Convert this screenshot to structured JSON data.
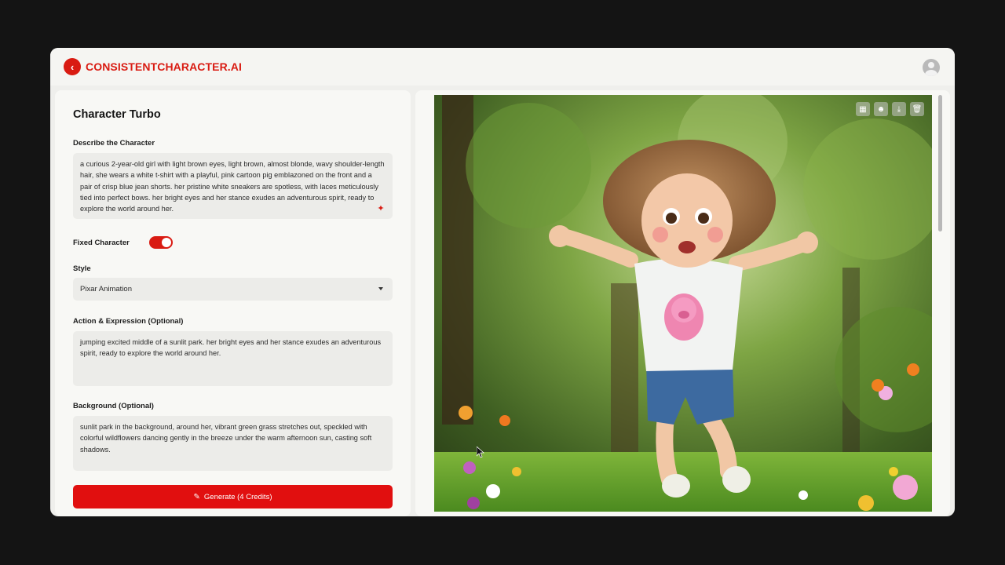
{
  "brand": {
    "name": "CONSISTENTCHARACTER.AI"
  },
  "form": {
    "title": "Character Turbo",
    "describe_label": "Describe the Character",
    "describe_value": "a curious 2-year-old girl with light brown eyes, light brown, almost blonde, wavy shoulder-length hair, she wears a white t-shirt with a playful, pink cartoon pig emblazoned on the front and a pair of crisp blue jean shorts. her pristine white sneakers are spotless, with laces meticulously tied into perfect bows. her bright eyes and her stance exudes an adventurous spirit, ready to explore the world around her.",
    "fixed_character_label": "Fixed Character",
    "fixed_character_on": true,
    "style_label": "Style",
    "style_value": "Pixar Animation",
    "action_label": "Action & Expression (Optional)",
    "action_value": "jumping excited  middle of a sunlit park. her bright eyes and her stance exudes an adventurous spirit, ready to explore the world around her.",
    "background_label": "Background (Optional)",
    "background_value": "sunlit park in the background,  around her, vibrant green grass stretches out, speckled with colorful wildflowers dancing gently in the breeze under the warm afternoon sun, casting soft shadows.",
    "generate_label": "Generate (4 Credits)"
  },
  "image_toolbar": [
    "grid-icon",
    "face-icon",
    "download-icon",
    "trash-icon"
  ],
  "colors": {
    "accent": "#d91b12",
    "panel": "#f8f8f5",
    "field": "#ecece9"
  }
}
